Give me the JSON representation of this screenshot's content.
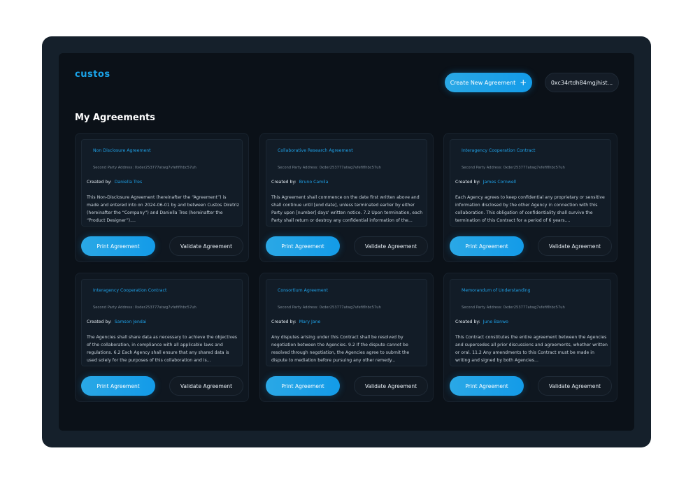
{
  "header": {
    "logo": "custos",
    "create_label": "Create New Agreement",
    "create_icon": "plus-icon",
    "wallet_address": "0xc34rtdh84mgjhist..."
  },
  "page_title": "My Agreements",
  "labels": {
    "address_prefix": "Second Party Address: ",
    "created_by": "Created by:",
    "print": "Print Agreement",
    "validate": "Validate Agreement"
  },
  "agreements": [
    {
      "title": "Non Disclosure Agreement",
      "address": "Second Party Address: 0xder253777atwg7vfefiflhbc57uh",
      "created_by": "Daniella Tres",
      "text": "This Non-Disclosure Agreement (hereinafter the “Agreement”) is made and entered into on 2024-06-01 by and between Custos Diretriz (hereinafter the “Company”) and Daniella Tres (hereinafter the “Product Designer”)...."
    },
    {
      "title": "Collaborative Research Agreement",
      "address": "Second Party Address: 0xder253777atwg7vfefiflhbc57uh",
      "created_by": "Bruno Camila",
      "text": "This Agreement shall commence on the date first written above and shall continue until [end date], unless terminated earlier by either Party upon [number] days' written notice. 7.2 Upon termination, each Party shall return or destroy any confidential information of the..."
    },
    {
      "title": "Interagency Cooperation Contract",
      "address": "Second Party Address: 0xder253777atwg7vfefiflhbc57uh",
      "created_by": "James Cornwell",
      "text": "Each Agency agrees to keep confidential any proprietary or sensitive information disclosed by the other Agency in connection with this collaboration. This obligation of confidentiality shall survive the termination of this Contract for a period of 6 years...."
    },
    {
      "title": "Interagency Cooperation Contract",
      "address": "Second Party Address: 0xder253777atwg7vfefiflhbc57uh",
      "created_by": "Samson Jendai",
      "text": "The Agencies shall share data as necessary to achieve the objectives of the collaboration, in compliance with all applicable laws and regulations. 6.2 Each Agency shall ensure that any shared data is used solely for the purposes of this collaboration and is..."
    },
    {
      "title": "Consortium Agreement",
      "address": "Second Party Address: 0xder253777atwg7vfefiflhbc57uh",
      "created_by": "Mary Jane",
      "text": "Any disputes arising under this Contract shall be resolved by negotiation between the Agencies. 9.2 If the dispute cannot be resolved through negotiation, the Agencies agree to submit the dispute to mediation before pursuing any other remedy..."
    },
    {
      "title": "Memorandum of Understanding",
      "address": "Second Party Address: 0xder253777atwg7vfefiflhbc57uh",
      "created_by": "June Banwo",
      "text": "This Contract constitutes the entire agreement between the Agencies and supersedes all prior discussions and agreements, whether written or oral. 11.2 Any amendments to this Contract must be made in writing and signed by both Agencies..."
    }
  ],
  "colors": {
    "accent": "#1ea0e6",
    "background": "#0b1118",
    "frame": "#15202b"
  }
}
